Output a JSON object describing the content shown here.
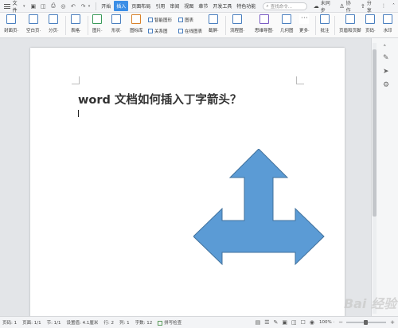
{
  "menubar": {
    "file_label": "文件",
    "tabs": [
      "开始",
      "插入",
      "页面布局",
      "引用",
      "审阅",
      "视图",
      "章节",
      "开发工具",
      "特色功能"
    ],
    "active_tab": "插入",
    "search_placeholder": "查找命令...",
    "sync_label": "未同步",
    "collab_label": "协作",
    "share_label": "分享"
  },
  "ribbon": {
    "buttons": [
      {
        "label": "封面页·",
        "icon": "cover-page-icon"
      },
      {
        "label": "空白页·",
        "icon": "blank-page-icon"
      },
      {
        "label": "分页·",
        "icon": "page-break-icon"
      },
      {
        "label": "表格·",
        "icon": "table-icon"
      },
      {
        "label": "图片·",
        "icon": "picture-icon"
      },
      {
        "label": "形状·",
        "icon": "shape-icon"
      },
      {
        "label": "图标库",
        "icon": "icon-library-icon"
      },
      {
        "label": "截屏·",
        "icon": "screenshot-icon"
      },
      {
        "label": "流程图·",
        "icon": "flowchart-icon"
      },
      {
        "label": "思维导图·",
        "icon": "mindmap-icon"
      },
      {
        "label": "几何图",
        "icon": "geometry-icon"
      },
      {
        "label": "更多·",
        "icon": "more-icon"
      },
      {
        "label": "批注",
        "icon": "comment-icon"
      },
      {
        "label": "页眉和页脚",
        "icon": "header-footer-icon"
      },
      {
        "label": "页码·",
        "icon": "page-number-icon"
      },
      {
        "label": "水印",
        "icon": "watermark-icon"
      }
    ],
    "small_items": [
      "智能图形",
      "图表",
      "关系图",
      "在线图表"
    ]
  },
  "document": {
    "title": "word 文档如何插入丁字箭头？",
    "shape": "t-arrow",
    "shape_color": "#5b9bd5",
    "shape_stroke": "#41719c"
  },
  "statusbar": {
    "page_num": "页码: 1",
    "page_of": "页面: 1/1",
    "section": "节: 1/1",
    "position": "设置值: 4.1厘米",
    "row": "行: 2",
    "col": "列: 1",
    "word_count": "字数: 12",
    "spell_check": "拼写检查",
    "zoom": "100% ·"
  },
  "watermark_text": "Bai 经验"
}
